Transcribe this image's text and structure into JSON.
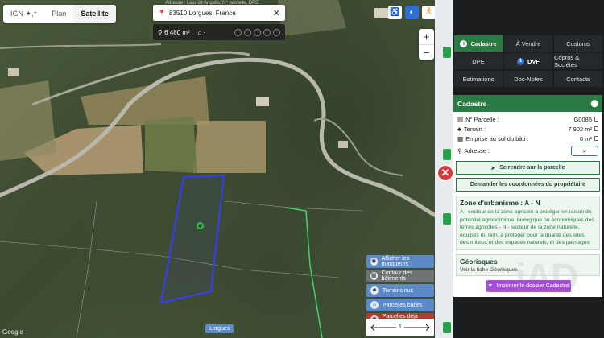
{
  "map": {
    "switcher": {
      "ign": "IGN ✦,⁺",
      "plan": "Plan",
      "satellite": "Satellite"
    },
    "search": {
      "value": "83510 Lorgues, France",
      "hint": "Adresse : Lieu-dit Angelis, N° parcelle, DPE",
      "clear": "✕"
    },
    "area_bar": {
      "area": "6 480 m²",
      "home": "-"
    },
    "zoom": {
      "plus": "+",
      "minus": "−"
    },
    "close": "✕",
    "layers": [
      {
        "label": "Afficher les marqueurs",
        "icon": "eye-icon"
      },
      {
        "label": "Contour des bâtiments",
        "icon": "building-icon"
      },
      {
        "label": "Terrains nus",
        "icon": "tree-icon"
      },
      {
        "label": "Parcelles bâties",
        "icon": "home-icon"
      },
      {
        "label": "Parcelles déjà vues",
        "icon": "eye-icon"
      }
    ],
    "nav": {
      "prev": "🡐",
      "next": "🡒",
      "page": "1"
    },
    "place_label": "Lorgues",
    "google": "Google"
  },
  "panel": {
    "tabs": [
      {
        "label": "Cadastre",
        "active": true
      },
      {
        "label": "À Vendre"
      },
      {
        "label": "Customs"
      },
      {
        "label": "DPE"
      },
      {
        "label": "DVF",
        "badge": "1"
      },
      {
        "label": "Copros & Sociétés"
      },
      {
        "label": "Estimations"
      },
      {
        "label": "Doc-Notes"
      },
      {
        "label": "Contacts"
      }
    ],
    "card": {
      "title": "Cadastre",
      "rows": [
        {
          "label": "N° Parcelle :",
          "value": "G0085"
        },
        {
          "label": "Terrain :",
          "value": "7 902 m²"
        },
        {
          "label": "Emprise au sol du bâti :",
          "value": "0 m²"
        }
      ],
      "address_label": "Adresse :",
      "goto": "Se rendre sur la parcelle",
      "owner": "Demander les coordonnées du propriétaire",
      "zoning_title": "Zone d'urbanisme : A - N",
      "zoning_text": "A - secteur de la zone agricole à protéger en raison du potentiel agronomique, biologique ou économiques des terres agricoles - N - secteur de la zone naturelle, équipés ou non, à protéger pour la qualité des sites, des milieux et des espaces naturels, et des paysages",
      "georisques_title": "Géorisques",
      "georisques_link": "Voir la fiche Géorisques",
      "print": "Imprimer le dossier Cadastral"
    }
  },
  "colors": {
    "green": "#2a7a43",
    "parcel_outline": "#3a3fd8",
    "neighbour_outline": "#3fd66b"
  }
}
